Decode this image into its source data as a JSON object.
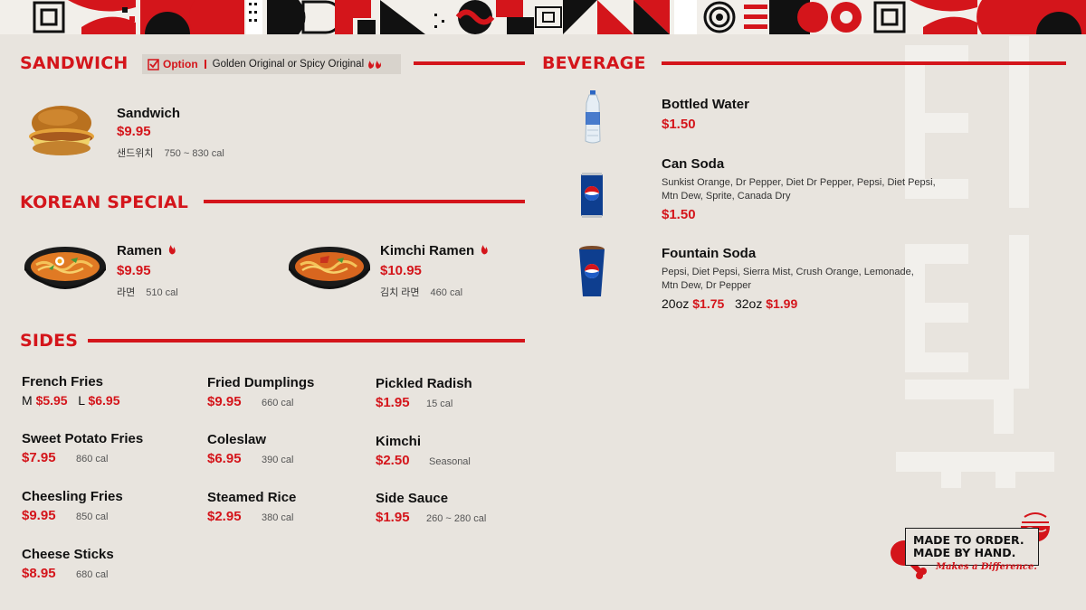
{
  "sandwich": {
    "title": "SANDWICH",
    "option_label": "Option",
    "option_text": "Golden Original or Spicy Original",
    "items": [
      {
        "name": "Sandwich",
        "price": "$9.95",
        "korean": "샌드위치",
        "cal": "750 ~ 830 cal"
      }
    ]
  },
  "korean_special": {
    "title": "KOREAN SPECIAL",
    "items": [
      {
        "name": "Ramen",
        "price": "$9.95",
        "korean": "라면",
        "cal": "510 cal",
        "spicy_icon": "flame-icon"
      },
      {
        "name": "Kimchi Ramen",
        "price": "$10.95",
        "korean": "김치 라면",
        "cal": "460 cal",
        "spicy_icon": "flame-icon"
      }
    ]
  },
  "sides": {
    "title": "SIDES",
    "items": [
      {
        "name": "French Fries",
        "size_m": "M",
        "price_m": "$5.95",
        "size_l": "L",
        "price_l": "$6.95"
      },
      {
        "name": "Sweet Potato Fries",
        "price": "$7.95",
        "cal": "860 cal"
      },
      {
        "name": "Cheesling Fries",
        "price": "$9.95",
        "cal": "850 cal"
      },
      {
        "name": "Cheese Sticks",
        "price": "$8.95",
        "cal": "680 cal"
      },
      {
        "name": "Fried Dumplings",
        "price": "$9.95",
        "cal": "660 cal"
      },
      {
        "name": "Coleslaw",
        "price": "$6.95",
        "cal": "390 cal"
      },
      {
        "name": "Steamed Rice",
        "price": "$2.95",
        "cal": "380 cal"
      },
      {
        "name": "Pickled Radish",
        "price": "$1.95",
        "cal": "15 cal"
      },
      {
        "name": "Kimchi",
        "price": "$2.50",
        "cal": "Seasonal"
      },
      {
        "name": "Side Sauce",
        "price": "$1.95",
        "cal": "260 ~ 280 cal"
      }
    ]
  },
  "beverage": {
    "title": "BEVERAGE",
    "items": [
      {
        "name": "Bottled Water",
        "price": "$1.50"
      },
      {
        "name": "Can Soda",
        "desc_line1": "Sunkist Orange, Dr Pepper, Diet Dr Pepper, Pepsi, Diet Pepsi,",
        "desc_line2": "Mtn Dew, Sprite, Canada Dry",
        "price": "$1.50"
      },
      {
        "name": "Fountain Soda",
        "desc_line1": "Pepsi, Diet Pepsi, Sierra Mist, Crush Orange, Lemonade,",
        "desc_line2": "Mtn Dew, Dr Pepper",
        "size_1": "20oz",
        "price_1": "$1.75",
        "size_2": "32oz",
        "price_2": "$1.99"
      }
    ]
  },
  "badge": {
    "line1": "MADE TO ORDER.",
    "line2": "MADE BY HAND.",
    "tagline": "Makes a Difference."
  },
  "colors": {
    "accent": "#d4151b",
    "background": "#e8e4de",
    "text": "#111111"
  }
}
